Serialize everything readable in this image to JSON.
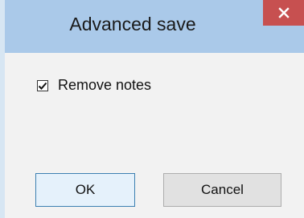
{
  "dialog": {
    "title": "Advanced save",
    "close_icon": "close-icon",
    "options": [
      {
        "label": "Remove notes",
        "checked": true
      }
    ],
    "buttons": {
      "ok_label": "OK",
      "cancel_label": "Cancel"
    }
  },
  "colors": {
    "titlebar": "#aac9e9",
    "close_button": "#c75050",
    "body": "#f2f2f2",
    "default_button_border": "#3c7fb1"
  }
}
